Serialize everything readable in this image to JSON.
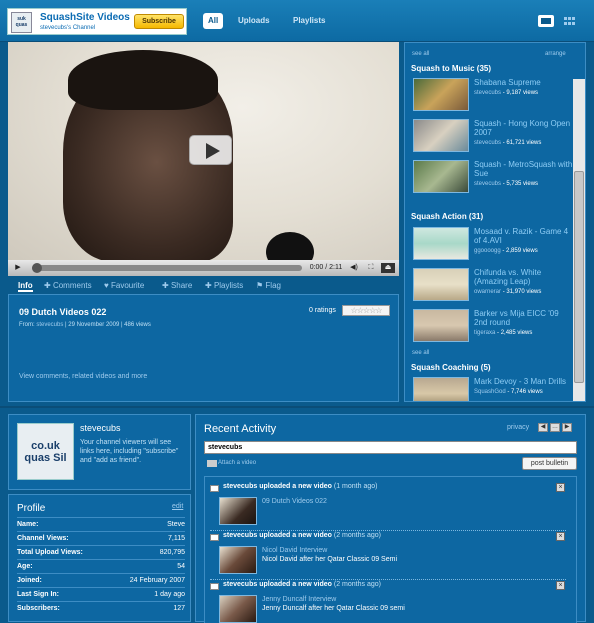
{
  "header": {
    "channel_thumb_text": "suk quas",
    "channel_title": "SquashSite Videos",
    "channel_sub": "stevecubs's Channel",
    "subscribe_label": "Subscribe",
    "tabs": [
      {
        "label": "All",
        "active": true
      },
      {
        "label": "Uploads",
        "active": false
      },
      {
        "label": "Playlists",
        "active": false
      }
    ]
  },
  "player": {
    "time": "0:00 / 2:11"
  },
  "video_tabs": [
    {
      "label": "Info",
      "active": true
    },
    {
      "label": "Comments",
      "active": false
    },
    {
      "label": "Favourite",
      "active": false
    },
    {
      "label": "Share",
      "active": false
    },
    {
      "label": "Playlists",
      "active": false
    },
    {
      "label": "Flag",
      "active": false
    }
  ],
  "info": {
    "title": "09 Dutch Videos 022",
    "from_label": "From:",
    "from_user": "stevecubs",
    "meta_rest": "| 29 November 2009 | 486 views",
    "ratings": "0 ratings",
    "stars": "☆☆☆☆☆",
    "more_link": "View comments, related videos and more"
  },
  "playlists": {
    "see_all": "see all",
    "arrange": "arrange",
    "categories": [
      {
        "name": "Squash to Music (35)",
        "items": [
          {
            "title": "Shabana Supreme",
            "user": "stevecubs",
            "views": "- 9,187 views"
          },
          {
            "title": "Squash - Hong Kong Open 2007",
            "user": "stevecubs",
            "views": "- 61,721 views"
          },
          {
            "title": "Squash - MetroSquash with Sue",
            "user": "stevecubs",
            "views": "- 5,735 views"
          }
        ]
      },
      {
        "name": "Squash Action (31)",
        "items": [
          {
            "title": "Mosaad v. Razik - Game 4 of 4.AVI",
            "user": "ggoooogg",
            "views": "- 2,859 views"
          },
          {
            "title": "Chifunda vs. White (Amazing Leap)",
            "user": "owarnerar",
            "views": "- 31,970 views"
          },
          {
            "title": "Barker vs Mija EICC '09 2nd round",
            "user": "tigeraxa",
            "views": "- 2,485 views"
          }
        ]
      },
      {
        "name": "Squash Coaching (5)",
        "items": [
          {
            "title": "Mark Devoy - 3 Man Drills",
            "user": "SquashGod",
            "views": "- 7,746 views"
          }
        ]
      }
    ]
  },
  "about": {
    "avatar_text": "co.uk quas Sil",
    "name": "stevecubs",
    "message": "Your channel viewers will see links here, including \"subscribe\" and \"add as friend\"."
  },
  "profile": {
    "title": "Profile",
    "edit": "edit",
    "rows": [
      {
        "key": "Name:",
        "value": "Steve"
      },
      {
        "key": "Channel Views:",
        "value": "7,115"
      },
      {
        "key": "Total Upload Views:",
        "value": "820,795"
      },
      {
        "key": "Age:",
        "value": "54"
      },
      {
        "key": "Joined:",
        "value": "24 February 2007"
      },
      {
        "key": "Last Sign In:",
        "value": "1 day ago"
      },
      {
        "key": "Subscribers:",
        "value": "127"
      }
    ]
  },
  "activity": {
    "title": "Recent Activity",
    "privacy": "privacy",
    "input_value": "stevecubs",
    "attach": "Attach a video",
    "post": "post bulletin",
    "entries": [
      {
        "user": "stevecubs",
        "action": "uploaded a new video",
        "ago": "(1 month ago)",
        "video": "09 Dutch Videos 022",
        "desc": ""
      },
      {
        "user": "stevecubs",
        "action": "uploaded a new video",
        "ago": "(2 months ago)",
        "video": "Nicol David Interview",
        "desc": "Nicol David after her Qatar Classic 09 Semi"
      },
      {
        "user": "stevecubs",
        "action": "uploaded a new video",
        "ago": "(2 months ago)",
        "video": "Jenny Duncalf Interview",
        "desc": "Jenny Duncalf after her Qatar Classic 09 semi"
      }
    ]
  },
  "colors": {
    "background": "#0a5a8c",
    "panel": "#0d67a2",
    "link": "#9ecbed",
    "subscribe": "#f5b800"
  }
}
